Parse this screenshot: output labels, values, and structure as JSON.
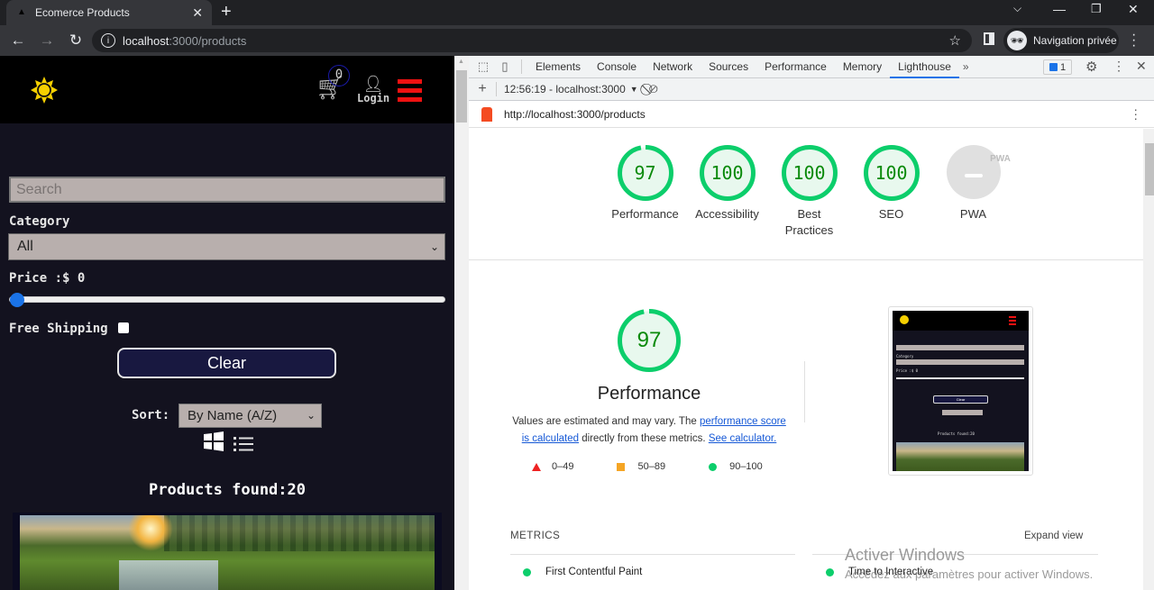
{
  "browser": {
    "tab_title": "Ecomerce Products",
    "url_host": "localhost",
    "url_path": ":3000/products",
    "profile_label": "Navigation privée"
  },
  "app": {
    "cart_count": "0",
    "login_label": "Login",
    "search_placeholder": "Search",
    "category_label": "Category",
    "category_value": "All",
    "price_label": "Price :$ 0",
    "price_slider_fraction": 0,
    "free_shipping_label": "Free Shipping",
    "free_shipping_checked": false,
    "clear_label": "Clear",
    "sort_label": "Sort:",
    "sort_value": "By Name (A/Z)",
    "products_found": "Products found:20",
    "accent_colors": {
      "sun": "#f5d000",
      "burger": "#ee1111",
      "slider": "#1a73e8"
    }
  },
  "devtools": {
    "tabs": [
      "Elements",
      "Console",
      "Network",
      "Sources",
      "Performance",
      "Memory",
      "Lighthouse"
    ],
    "active_tab": "Lighthouse",
    "issues_count": "1",
    "report_selector": "12:56:19 - localhost:3000",
    "report_url": "http://localhost:3000/products"
  },
  "lighthouse": {
    "scores": [
      {
        "label": "Performance",
        "value": "97",
        "score": 97
      },
      {
        "label": "Accessibility",
        "value": "100",
        "score": 100
      },
      {
        "label": "Best Practices",
        "value": "100",
        "score": 100
      },
      {
        "label": "SEO",
        "value": "100",
        "score": 100
      }
    ],
    "pwa_label": "PWA",
    "pwa_badge": "PWA",
    "performance": {
      "score": "97",
      "title": "Performance",
      "desc_1": "Values are estimated and may vary. The ",
      "link_1": "performance score is calculated",
      "desc_2": " directly from these metrics. ",
      "link_2": "See calculator."
    },
    "legend": [
      {
        "shape": "triangle",
        "range": "0–49",
        "color": "#ee2222"
      },
      {
        "shape": "square",
        "range": "50–89",
        "color": "#f5a524"
      },
      {
        "shape": "circle",
        "range": "90–100",
        "color": "#0cce6b"
      }
    ],
    "metrics_header": "METRICS",
    "expand_label": "Expand view",
    "metrics": [
      "First Contentful Paint",
      "Time to Interactive"
    ],
    "screenshot_thumb": {
      "price": "Price :$ 0",
      "category": "Category",
      "found": "Products found:20",
      "clear": "Clear"
    }
  },
  "os_watermark": {
    "title": "Activer Windows",
    "subtitle": "Accédez aux paramètres pour activer Windows."
  }
}
